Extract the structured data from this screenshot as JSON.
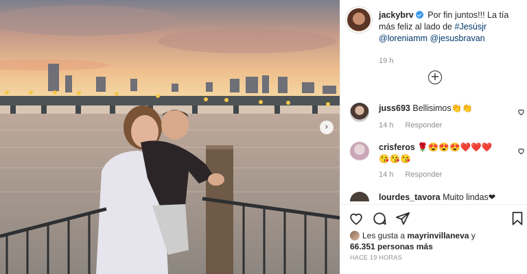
{
  "post": {
    "username": "jackybrv",
    "caption_text": "Por fin juntos!!! La tía más feliz al lado de",
    "tags": [
      "#Jesúsjr",
      "@loreniamm",
      "@jesusbravan"
    ],
    "time": "19 h"
  },
  "comments": [
    {
      "username": "juss693",
      "text": "Bellisimos👏👏",
      "time": "14 h",
      "reply": "Responder"
    },
    {
      "username": "crisferos",
      "text": "🌹😍😍😍❤️❤️❤️😘😘😘",
      "time": "14 h",
      "reply": "Responder"
    },
    {
      "username": "lourdes_tavora",
      "text": "Muito lindas❤❤"
    }
  ],
  "likes": {
    "prefix": "Les gusta a",
    "user": "mayrinvillaneva",
    "joiner": "y",
    "count": "66.351 personas más"
  },
  "posted_ago": "HACE 19 HORAS",
  "icons": {
    "next": "chevron-right-icon",
    "add": "plus-circle-icon",
    "like": "heart-icon",
    "comment": "comment-icon",
    "share": "paper-plane-icon",
    "save": "bookmark-icon"
  },
  "colors": {
    "verified": "#3897f0",
    "link": "#00376b",
    "muted": "#8e8e8e"
  }
}
